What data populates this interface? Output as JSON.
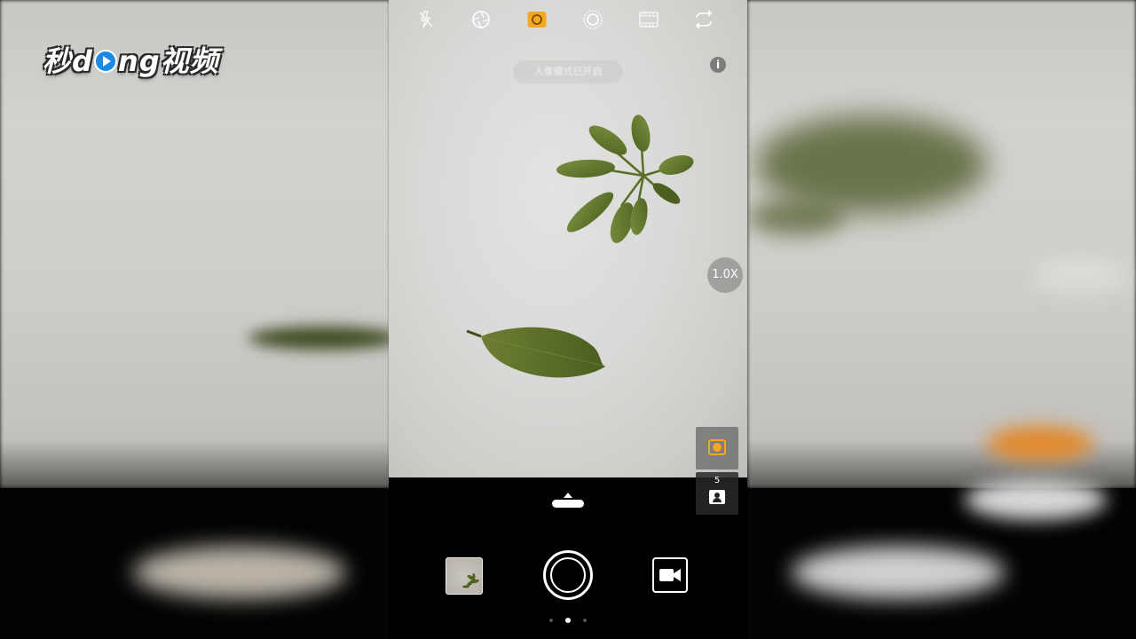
{
  "watermark": {
    "logo_left": "秒",
    "logo_mid": "d",
    "logo_right": "ng视频"
  },
  "camera": {
    "top_icons": [
      {
        "name": "flash-off-icon",
        "active": false
      },
      {
        "name": "aperture-icon",
        "active": false
      },
      {
        "name": "portrait-mode-icon",
        "active": true
      },
      {
        "name": "filter-icon",
        "active": false
      },
      {
        "name": "film-icon",
        "active": false
      },
      {
        "name": "switch-camera-icon",
        "active": false
      }
    ],
    "info_label": "i",
    "toast_text": "人像模式已开启",
    "zoom_label": "1.0X",
    "timer_count": "5",
    "page_count": 3,
    "active_page": 1
  },
  "colors": {
    "accent": "#f5a623",
    "viewfinder_bg": "#d9d9d7",
    "leaf_green": "#5f7a2c"
  }
}
